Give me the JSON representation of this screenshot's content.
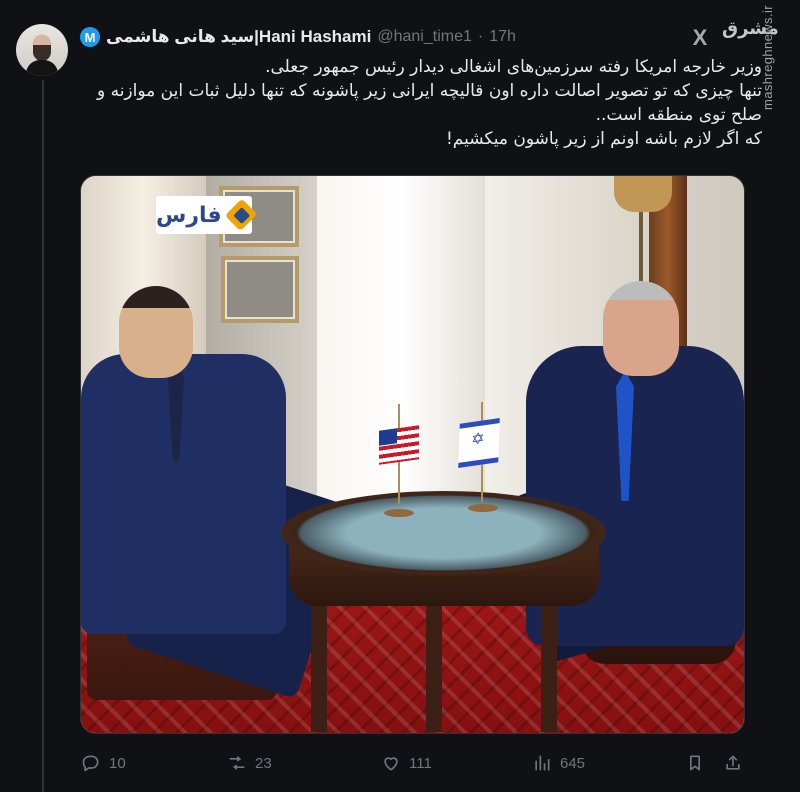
{
  "author": {
    "verified_badge": "M",
    "display_name": "سید هانی هاشمی|Hani Hashami",
    "handle": "@hani_time1",
    "time": "17h"
  },
  "branding": {
    "x_logo": "X",
    "site_logo": "مشرق",
    "watermark": "mashreghnews.ir"
  },
  "tweet": {
    "lines": [
      "وزیر خارجه امریکا رفته سرزمین‌های اشغالی دیدار رئیس جمهور جعلی.",
      "تنها چیزی که تو تصویر اصالت داره اون قالیچه ایرانی زیر پاشونه که تنها دلیل ثبات این موازنه و صلح توی منطقه است..",
      "که اگر لازم باشه اونم از زیر پاشون میکشیم!"
    ]
  },
  "media": {
    "logo_text": "فارس"
  },
  "stats": {
    "replies": "10",
    "retweets": "23",
    "likes": "111",
    "views": "645"
  },
  "icons": {
    "reply": "reply-icon",
    "retweet": "retweet-icon",
    "like": "heart-icon",
    "views": "views-icon",
    "bookmark": "bookmark-icon",
    "share": "share-icon"
  }
}
